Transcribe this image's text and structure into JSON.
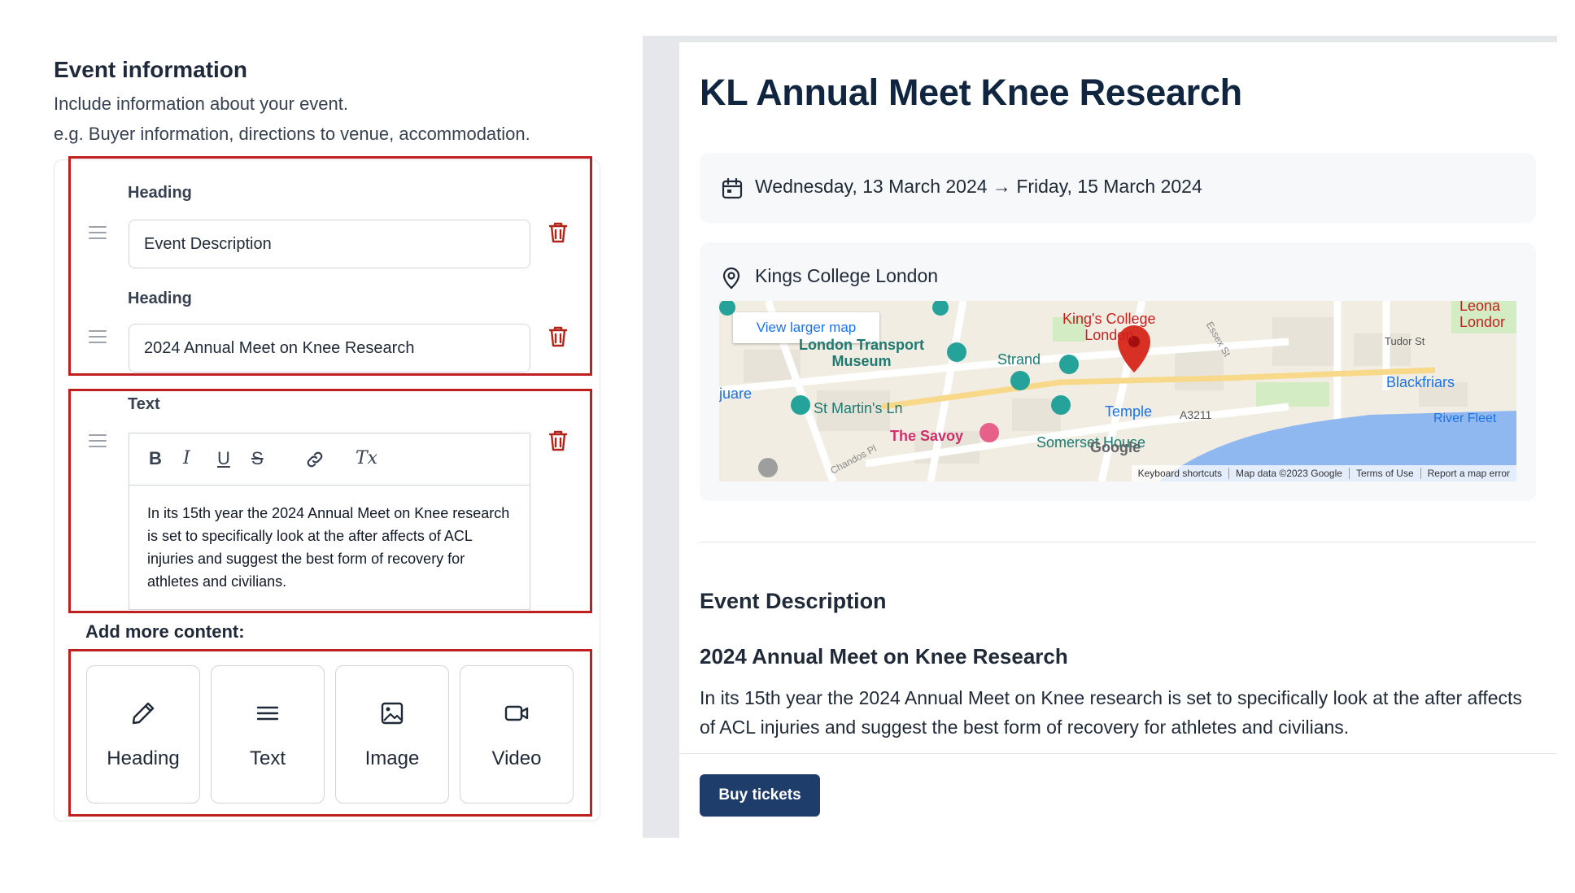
{
  "editor": {
    "title": "Event information",
    "subtitle_line1": "Include information about your event.",
    "subtitle_line2": "e.g. Buyer information, directions to venue, accommodation.",
    "blocks": [
      {
        "label": "Heading",
        "value": "Event Description"
      },
      {
        "label": "Heading",
        "value": "2024 Annual Meet on Knee Research"
      }
    ],
    "text_block": {
      "label": "Text",
      "toolbar": [
        "B",
        "I",
        "U",
        "S",
        "link",
        "Tx"
      ],
      "body": "In its 15th year the 2024 Annual Meet on Knee research is set to specifically look at the after affects of ACL injuries and suggest the best form of recovery for athletes and civilians."
    },
    "add_more_label": "Add more content:",
    "add_options": [
      {
        "label": "Heading",
        "icon": "pencil-icon"
      },
      {
        "label": "Text",
        "icon": "lines-icon"
      },
      {
        "label": "Image",
        "icon": "image-icon"
      },
      {
        "label": "Video",
        "icon": "video-icon"
      }
    ]
  },
  "preview": {
    "title": "KL Annual Meet Knee Research",
    "date_range": "Wednesday, 13 March 2024 → Friday, 15 March 2024",
    "location": "Kings College London",
    "map": {
      "view_larger": "View larger map",
      "labels": {
        "kings_college": "King's College\nLondon",
        "transport_museum": "London Transport\nMuseum",
        "strand": "Strand",
        "st_martins": "St Martin's Ln",
        "savoy": "The Savoy",
        "temple": "Temple",
        "somerset": "Somerset House",
        "blackfriars": "Blackfriars",
        "river_fleet": "River Fleet",
        "tudor_st": "Tudor St",
        "a3211": "A3211",
        "leonard": "Leona\nLondor",
        "square": "juare",
        "chandos": "Chandos Pl",
        "essex": "Essex St",
        "google": "Google"
      },
      "footer": [
        "Keyboard shortcuts",
        "Map data ©2023 Google",
        "Terms of Use",
        "Report a map error"
      ]
    },
    "section_title": "Event Description",
    "section_heading": "2024 Annual Meet on Knee Research",
    "section_body": "In its 15th year the 2024 Annual Meet on Knee research is set to specifically look at the after affects of ACL injuries and suggest the best form of recovery for athletes and civilians.",
    "buy_label": "Buy tickets"
  },
  "colors": {
    "accent_red": "#c01f1f",
    "trash_red": "#b42318",
    "buy_button": "#1f3d6b",
    "title_navy": "#0f2540"
  }
}
